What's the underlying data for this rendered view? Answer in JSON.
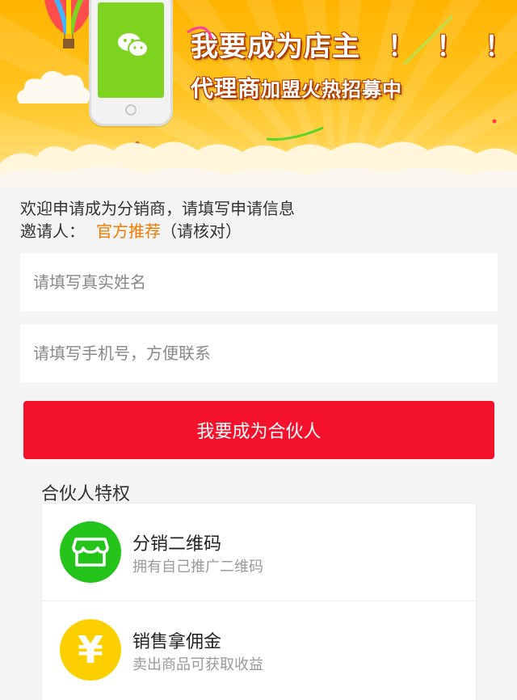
{
  "banner": {
    "headline": "我要成为店主",
    "exclaims": "！！！",
    "subhead_big": "代理商",
    "subhead_small": "加盟火热招募中"
  },
  "intro": {
    "welcome": "欢迎申请成为分销商，请填写申请信息",
    "inviter_label": "邀请人：",
    "inviter_value": "官方推荐",
    "inviter_note": "（请核对）"
  },
  "form": {
    "name_placeholder": "请填写真实姓名",
    "phone_placeholder": "请填写手机号，方便联系",
    "submit_label": "我要成为合伙人"
  },
  "perks": {
    "title": "合伙人特权",
    "items": [
      {
        "title": "分销二维码",
        "desc": "拥有自己推广二维码",
        "icon": "store-icon"
      },
      {
        "title": "销售拿佣金",
        "desc": "卖出商品可获取收益",
        "icon": "yen-icon"
      }
    ]
  },
  "colors": {
    "accent_red": "#f4112b",
    "accent_orange": "#f27a00",
    "banner_yellow": "#ffc21c",
    "green": "#25c41a",
    "yellow": "#fcd000"
  }
}
